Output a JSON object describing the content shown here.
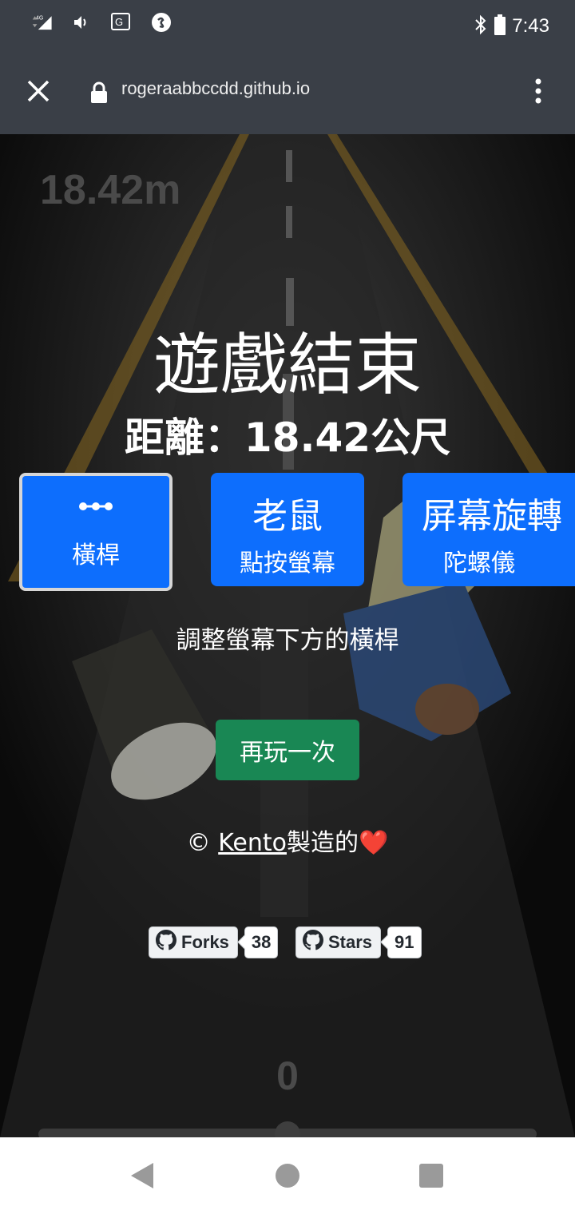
{
  "status_bar": {
    "network": "4G",
    "time": "7:43",
    "icons": [
      "signal-icon",
      "volume-icon",
      "translate-icon",
      "shazam-icon",
      "bluetooth-icon",
      "battery-icon"
    ]
  },
  "browser": {
    "url": "rogeraabbccdd.github.io",
    "icons": [
      "close-icon",
      "lock-icon",
      "more-vert-icon"
    ]
  },
  "game": {
    "hud_distance": "18.42m",
    "title": "遊戲結束",
    "distance_line": "距離：18.42公尺",
    "modes": [
      {
        "main": "",
        "sub": "橫桿",
        "icon": "slider-dots-icon",
        "active": true
      },
      {
        "main": "老鼠",
        "sub": "點按螢幕",
        "active": false
      },
      {
        "main": "屏幕旋轉",
        "sub": "陀螺儀",
        "active": false
      }
    ],
    "instruction": "調整螢幕下方的橫桿",
    "replay_label": "再玩一次",
    "credit": {
      "prefix": "© ",
      "author": "Kento",
      "suffix": "製造的",
      "heart": "❤️"
    },
    "github": {
      "forks_label": "Forks",
      "forks_count": "38",
      "stars_label": "Stars",
      "stars_count": "91"
    },
    "slider": {
      "value_label": "0",
      "position_fraction": 0.5
    }
  },
  "colors": {
    "primary": "#0d6efd",
    "success": "#198754",
    "bar_bg": "#3a3f47"
  }
}
